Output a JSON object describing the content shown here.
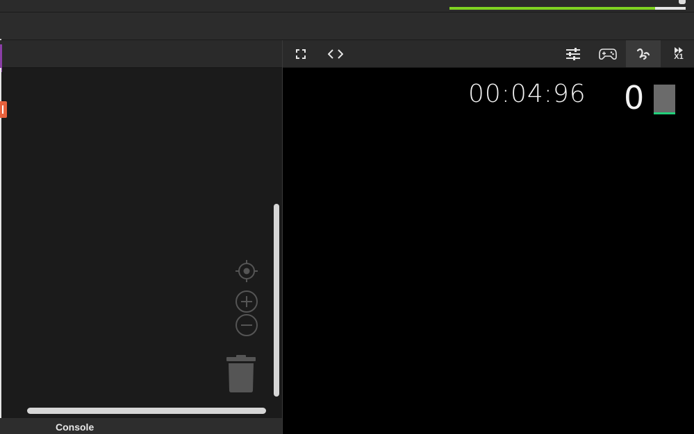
{
  "top_bar": {
    "progress_fraction": 0.87,
    "progress_color": "#7fd321"
  },
  "left_panel": {
    "controls": {
      "recenter_icon": "crosshair-icon",
      "zoom_in_icon": "zoom-in-icon",
      "zoom_out_icon": "zoom-out-icon",
      "delete_icon": "trash-icon"
    },
    "console_label": "Console"
  },
  "right_panel": {
    "toolbar": {
      "fullscreen_icon": "fullscreen-icon",
      "code_icon": "code-brackets-icon",
      "settings_icon": "sliders-icon",
      "gamepad_icon": "gamepad-icon",
      "draw_icon": "squiggle-icon",
      "speed_icon": "fast-forward-icon",
      "speed_label": "X1"
    },
    "stage": {
      "timer": "00:04:96",
      "score": "0",
      "level_accent": "#21d07a"
    }
  }
}
